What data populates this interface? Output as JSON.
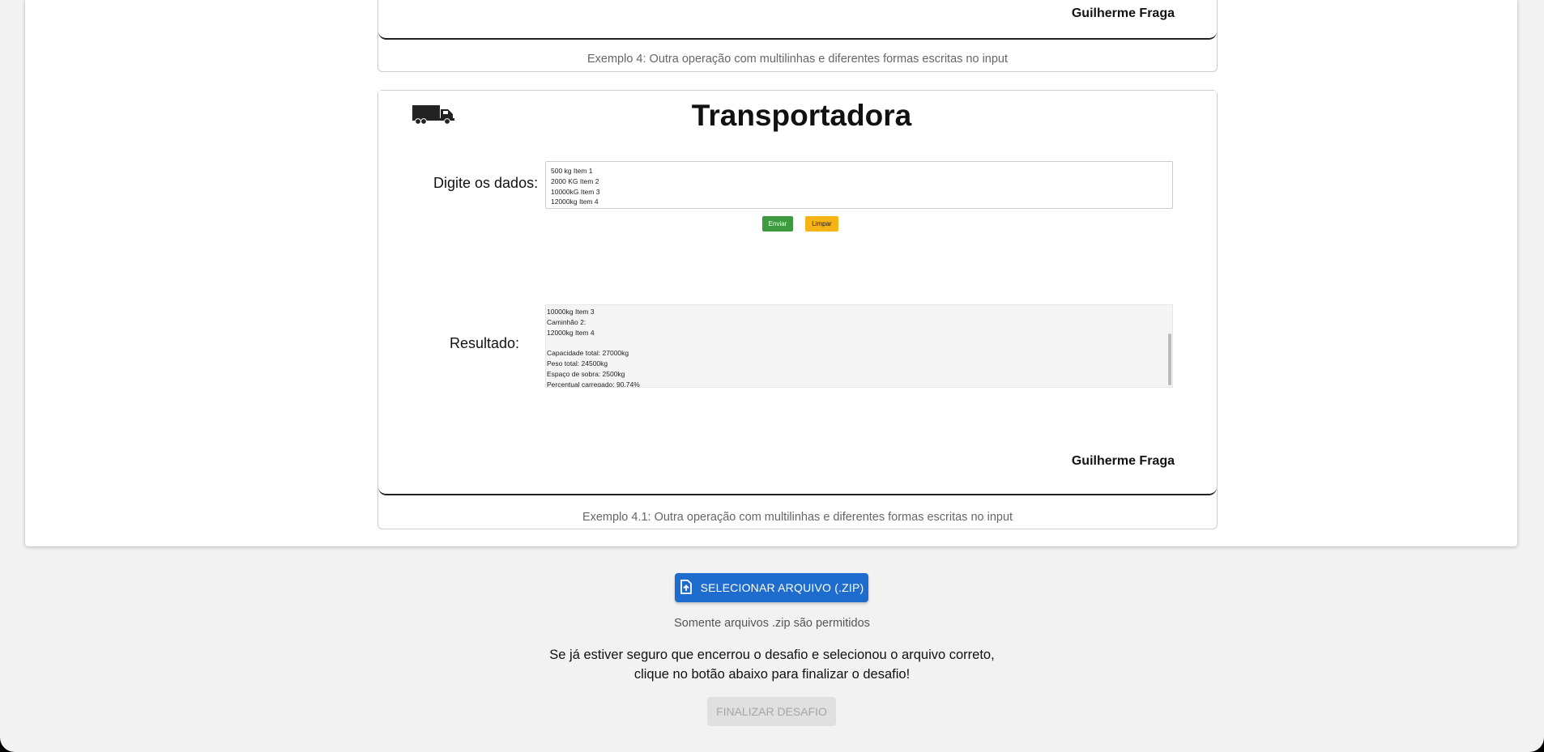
{
  "example4": {
    "author": "Guilherme Fraga",
    "caption": "Exemplo 4: Outra operação com multilinhas e diferentes formas escritas no input"
  },
  "example41": {
    "app_title": "Transportadora",
    "input_label": "Digite os dados:",
    "input_value": "500 kg Item 1\n2000 KG Item 2\n10000kG Item 3\n12000kg Item 4",
    "send_label": "Enviar",
    "clear_label": "Limpar",
    "result_label": "Resultado:",
    "result_lines": [
      "10000kg Item 3",
      "Caminhão 2:",
      "12000kg Item 4",
      "",
      "Capacidade total: 27000kg",
      "Peso total: 24500kg",
      "Espaço de sobra: 2500kg",
      "Percentual carregado: 90.74%"
    ],
    "author": "Guilherme Fraga",
    "caption": "Exemplo 4.1: Outra operação com multilinhas e diferentes formas escritas no input"
  },
  "upload": {
    "button_label": "SELECIONAR ARQUIVO (.ZIP)",
    "icon": "file-upload-icon",
    "hint": "Somente arquivos .zip são permitidos"
  },
  "finish": {
    "message_line1": "Se já estiver seguro que encerrou o desafio e selecionou o arquivo correto,",
    "message_line2": "clique no botão abaixo para finalizar o desafio!",
    "button_label": "FINALIZAR DESAFIO"
  },
  "colors": {
    "send_button": "#3d9a3f",
    "clear_button": "#f5b316",
    "upload_button": "#1f6ccf",
    "disabled_button": "#e0e0e0"
  }
}
